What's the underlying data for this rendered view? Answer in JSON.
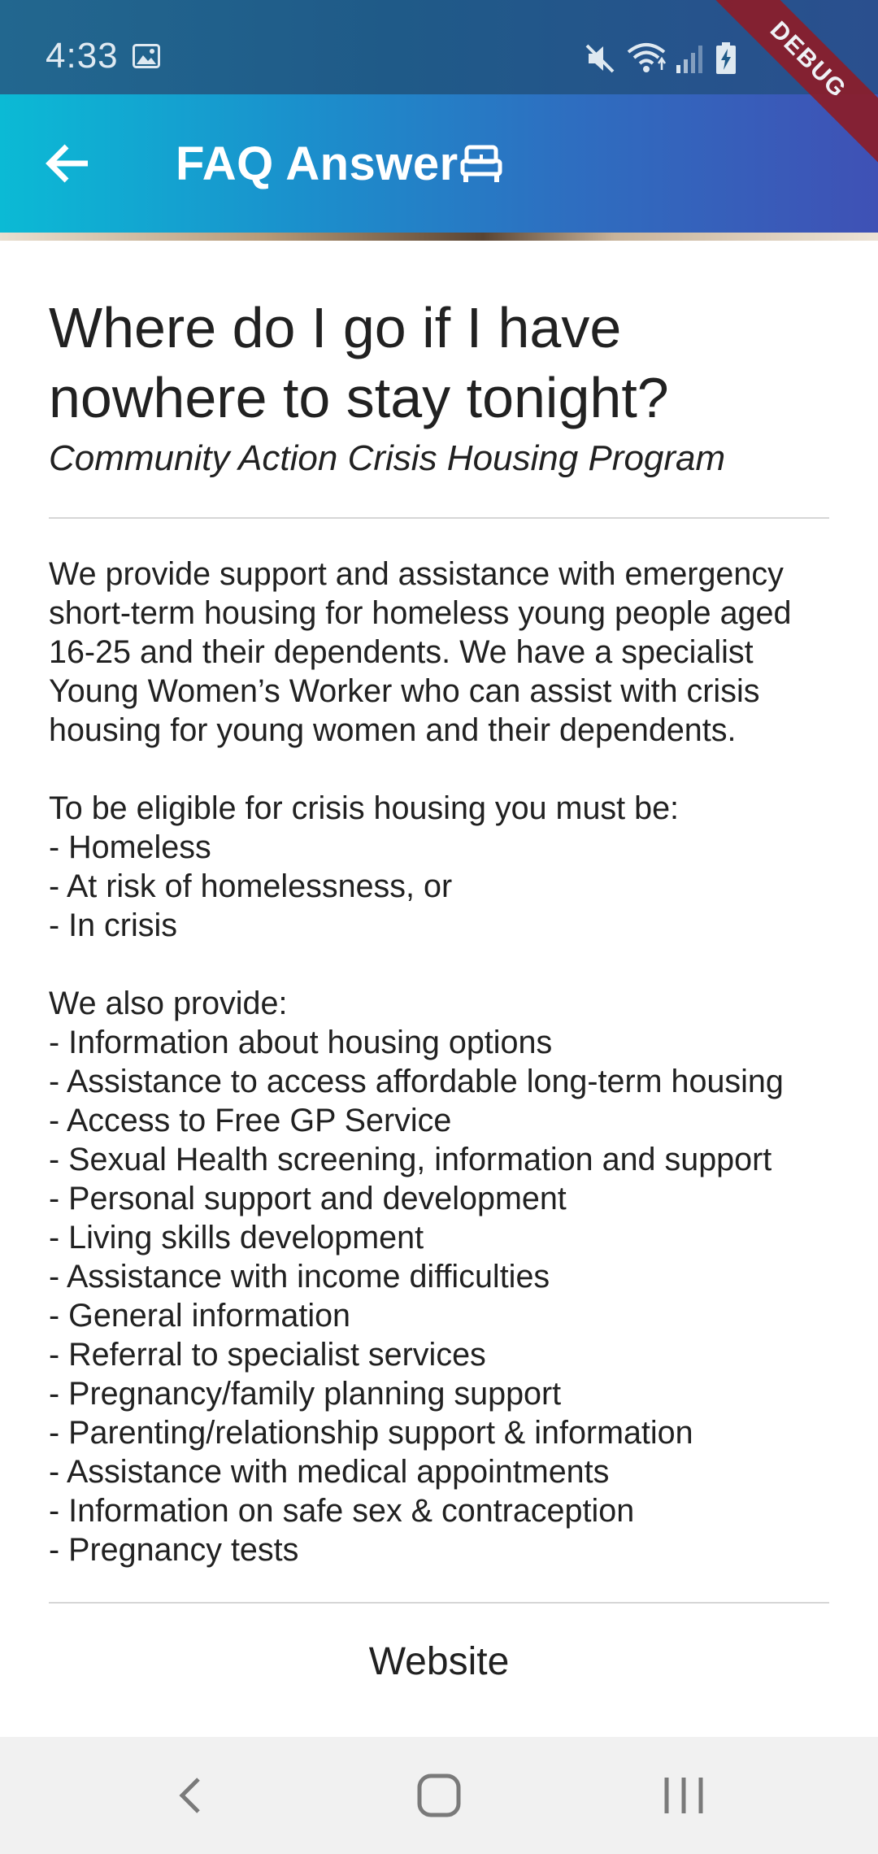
{
  "status_bar": {
    "time": "4:33",
    "icons": [
      "image-icon",
      "mute-icon",
      "wifi-icon",
      "signal-icon",
      "battery-charging-icon"
    ]
  },
  "app_bar": {
    "title": "FAQ Answer",
    "back_icon": "arrow-back-icon",
    "title_icon": "bed-icon",
    "gradient_start": "#0bbad5",
    "gradient_end": "#3f51b5"
  },
  "debug_banner": "DEBUG",
  "faq": {
    "question": "Where do I go if I have nowhere to stay tonight?",
    "provider": "Community Action Crisis Housing Program",
    "answer": "We provide support and assistance with emergency short-term housing for homeless young people aged 16-25 and their dependents. We have a specialist Young Women’s Worker who can assist with crisis housing for young women and their dependents.\n\nTo be eligible for crisis housing you must be:\n- Homeless\n- At risk of homelessness, or\n- In crisis\n\nWe also provide:\n- Information about housing options\n- Assistance to access affordable long-term housing\n- Access to Free GP Service\n- Sexual Health screening, information and support\n- Personal support and development\n- Living skills development\n- Assistance with income difficulties\n- General information\n- Referral to specialist services\n- Pregnancy/family planning support\n- Parenting/relationship support & information\n- Assistance with medical appointments\n- Information on safe sex & contraception\n- Pregnancy tests",
    "website_heading": "Website"
  },
  "nav_bar": {
    "icons": [
      "nav-back-icon",
      "nav-home-icon",
      "nav-recents-icon"
    ]
  }
}
